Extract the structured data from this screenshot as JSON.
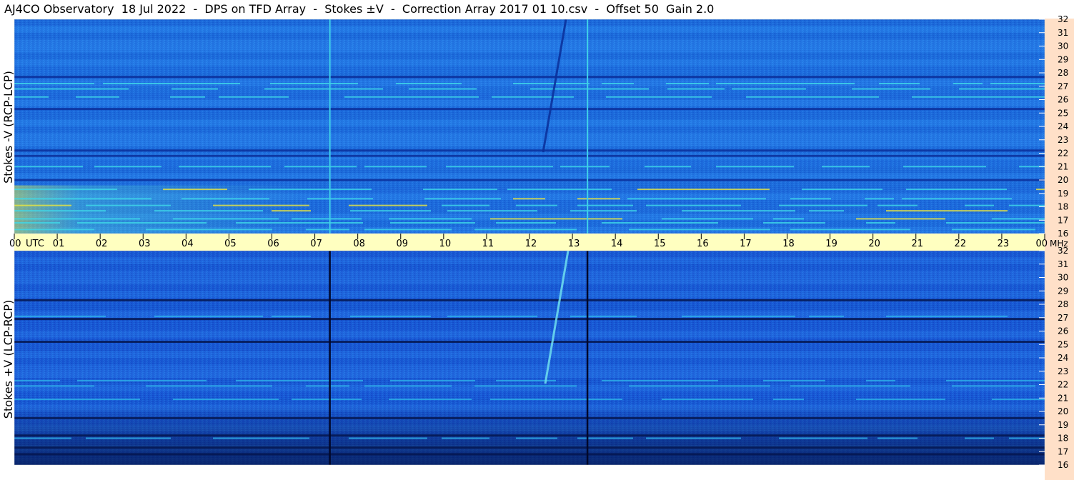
{
  "chart_data": {
    "type": "heatmap",
    "title": "AJ4CO Observatory  18 Jul 2022  -  DPS on TFD Array  -  Stokes ±V  -  Correction Array 2017 01 10.csv  -  Offset 50  Gain 2.0",
    "x_axis": {
      "label": "UTC",
      "unit": "UTC",
      "range": [
        0,
        24
      ],
      "tick_labels": [
        "00",
        "01",
        "02",
        "03",
        "04",
        "05",
        "06",
        "07",
        "08",
        "09",
        "10",
        "11",
        "12",
        "13",
        "14",
        "15",
        "16",
        "17",
        "18",
        "19",
        "20",
        "21",
        "22",
        "23",
        "00"
      ]
    },
    "y_axis": {
      "unit": "MHz",
      "range": [
        16,
        32
      ],
      "tick_labels": [
        "16",
        "17",
        "18",
        "19",
        "20",
        "21",
        "22",
        "23",
        "24",
        "25",
        "26",
        "27",
        "28",
        "29",
        "30",
        "31",
        "32"
      ]
    },
    "panels": [
      {
        "ylabel": "Stokes -V (RCP-LCP)",
        "colors": {
          "background": "#1f6fe0",
          "dark_band": "#0a2f9a",
          "bright_band": "#3fd8e8",
          "hot_band": "#e8e640"
        },
        "bright_bands_mhz": [
          16.3,
          16.8,
          17.1,
          17.7,
          18.1,
          18.6,
          19.3,
          21.0,
          26.2,
          26.8,
          27.2
        ],
        "dark_bands_mhz": [
          20.0,
          21.8,
          22.2,
          25.3,
          27.7
        ],
        "vertical_events_utc": [
          {
            "utc": 7.35,
            "kind": "line"
          },
          {
            "utc": 13.35,
            "kind": "line"
          },
          {
            "utc": 12.55,
            "kind": "drift"
          }
        ]
      },
      {
        "ylabel": "Stokes +V (LCP-RCP)",
        "colors": {
          "background": "#1a5ad8",
          "dark_band": "#05164f",
          "bright_band": "#2fb4ea",
          "hot_band": "#9ef07a"
        },
        "bright_bands_mhz": [
          21.9,
          22.3,
          20.9,
          27.1,
          18.0
        ],
        "dark_bands_mhz": [
          16.8,
          17.3,
          18.2,
          19.5,
          25.2,
          26.9,
          28.3
        ],
        "vertical_events_utc": [
          {
            "utc": 7.35,
            "kind": "dark-line"
          },
          {
            "utc": 13.35,
            "kind": "dark-line"
          },
          {
            "utc": 12.6,
            "kind": "drift"
          }
        ]
      }
    ],
    "axis_band_color": "#ffffc0",
    "side_band_color": "#ffe0c8"
  },
  "labels": {
    "utc_label": "UTC",
    "mhz_label": "MHz"
  }
}
